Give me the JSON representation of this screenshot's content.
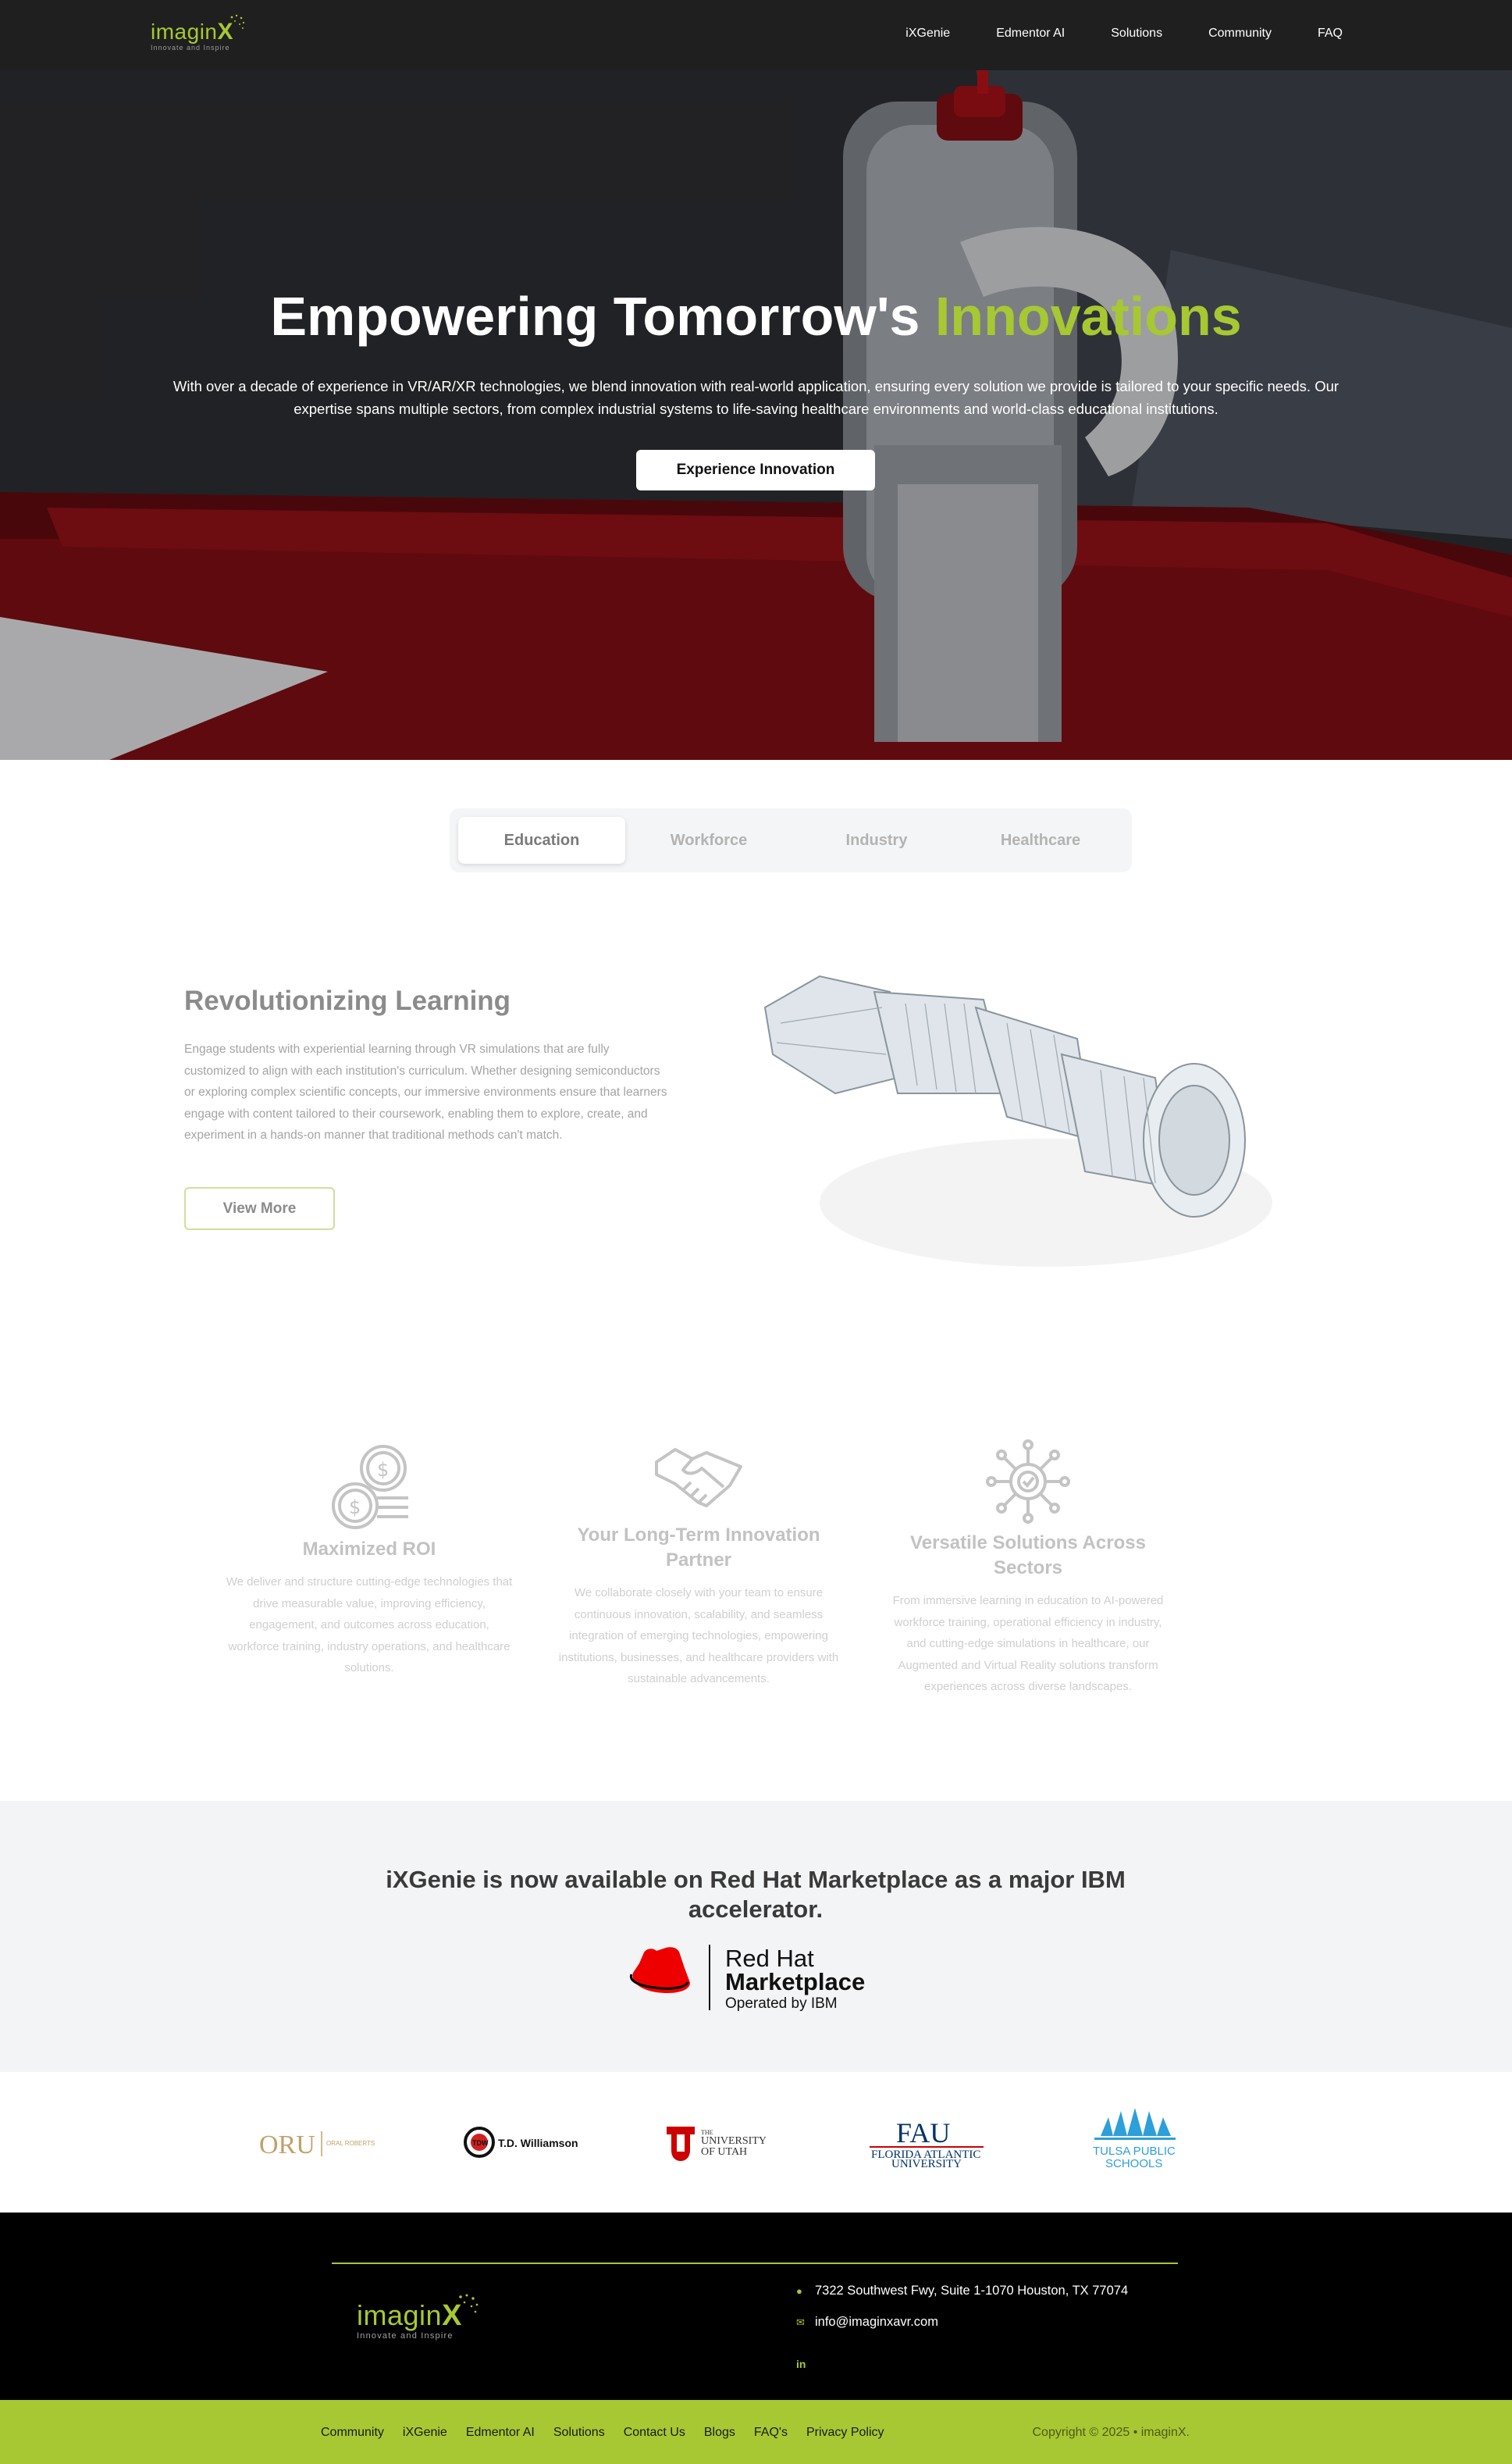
{
  "nav": {
    "logo_text": "imagin",
    "logo_x": "X",
    "logo_tagline": "Innovate and Inspire",
    "links": [
      "iXGenie",
      "Edmentor AI",
      "Solutions",
      "Community",
      "FAQ"
    ]
  },
  "hero": {
    "title_main": "Empowering Tomorrow's ",
    "title_accent": "Innovations",
    "description": "With over a decade of experience in VR/AR/XR technologies, we blend innovation with real-world application, ensuring every solution we provide is tailored to your specific needs. Our expertise spans multiple sectors, from complex industrial systems to life-saving healthcare environments and world-class educational institutions.",
    "cta_label": "Experience Innovation"
  },
  "tabs": {
    "items": [
      "Education",
      "Workforce",
      "Industry",
      "Healthcare"
    ],
    "active": "Education"
  },
  "feature": {
    "title": "Revolutionizing Learning",
    "text": "Engage students with experiential learning through VR simulations that are fully customized to align with each institution's curriculum. Whether designing semiconductors or exploring complex scientific concepts, our immersive environments ensure that learners engage with content tailored to their coursework, enabling them to explore, create, and experiment in a hands-on manner that traditional methods can't match.",
    "button_label": "View More"
  },
  "values": [
    {
      "icon": "coins-icon",
      "title": "Maximized ROI",
      "text": "We deliver and structure cutting-edge technologies that drive measurable value, improving efficiency, engagement, and outcomes across education, workforce training, industry operations, and healthcare solutions."
    },
    {
      "icon": "handshake-icon",
      "title": "Your Long-Term Innovation Partner",
      "text": "We collaborate closely with your team to ensure continuous innovation, scalability, and seamless integration of emerging technologies, empowering institutions, businesses, and healthcare providers with sustainable advancements."
    },
    {
      "icon": "network-gear-icon",
      "title": "Versatile Solutions Across Sectors",
      "text": "From immersive learning in education to AI-powered workforce training, operational efficiency in industry, and cutting-edge simulations in healthcare, our Augmented and Virtual Reality solutions transform experiences across diverse landscapes."
    }
  ],
  "redhat": {
    "title": "iXGenie is now available on Red Hat Marketplace as a major IBM accelerator.",
    "logo_line1": "Red Hat",
    "logo_line2": "Marketplace",
    "logo_line3": "Operated by IBM",
    "brand_color": "#ee0000"
  },
  "partners": {
    "oru_short": "ORU",
    "oru_full": "ORAL ROBERTS UNIVERSITY",
    "tdw_badge": "TDW",
    "tdw_name": "T.D. Williamson",
    "utah_the": "THE",
    "utah_university": "UNIVERSITY",
    "utah_of": "OF UTAH",
    "fau_short": "FAU",
    "fau_line1": "FLORIDA ATLANTIC",
    "fau_line2": "UNIVERSITY",
    "tulsa_line1": "TULSA PUBLIC",
    "tulsa_line2": "SCHOOLS"
  },
  "footer": {
    "address": "7322 Southwest Fwy, Suite 1-1070 Houston, TX 77074",
    "email": "info@imaginxavr.com",
    "linkedin": "in",
    "bottom_links": [
      "Community",
      "iXGenie",
      "Edmentor AI",
      "Solutions",
      "Contact Us",
      "Blogs",
      "FAQ's",
      "Privacy Policy"
    ],
    "copyright": "Copyright © 2025 • imaginX."
  },
  "colors": {
    "accent": "#a7c832",
    "nav_bg": "#1f1f1f",
    "footer_bg": "#000000"
  }
}
